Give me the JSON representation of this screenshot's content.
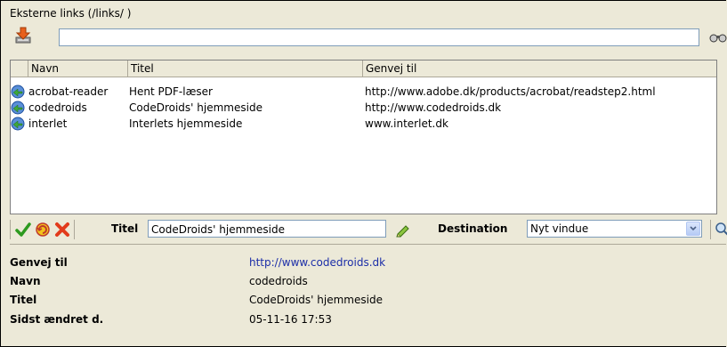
{
  "section_title": "Eksterne links (/links/ )",
  "search": {
    "value": ""
  },
  "list": {
    "columns": [
      "Navn",
      "Titel",
      "Genvej til"
    ],
    "rows": [
      {
        "name": "acrobat-reader",
        "title": "Hent PDF-læser",
        "url": "http://www.adobe.dk/products/acrobat/readstep2.html"
      },
      {
        "name": "codedroids",
        "title": "CodeDroids' hjemmeside",
        "url": "http://www.codedroids.dk"
      },
      {
        "name": "interlet",
        "title": "Interlets hjemmeside",
        "url": "www.interlet.dk"
      }
    ]
  },
  "editor": {
    "title_label": "Titel",
    "title_value": "CodeDroids' hjemmeside",
    "destination_label": "Destination",
    "destination_value": "Nyt vindue"
  },
  "details": {
    "shortcut_label": "Genvej til",
    "shortcut_value": "http://www.codedroids.dk",
    "name_label": "Navn",
    "name_value": "codedroids",
    "title_label": "Titel",
    "title_value": "CodeDroids' hjemmeside",
    "changed_label": "Sidst ændret d.",
    "changed_value": "05-11-16 17:53"
  },
  "colors": {
    "accent_link": "#1c2ea8",
    "panel_bg": "#ece9d8"
  }
}
